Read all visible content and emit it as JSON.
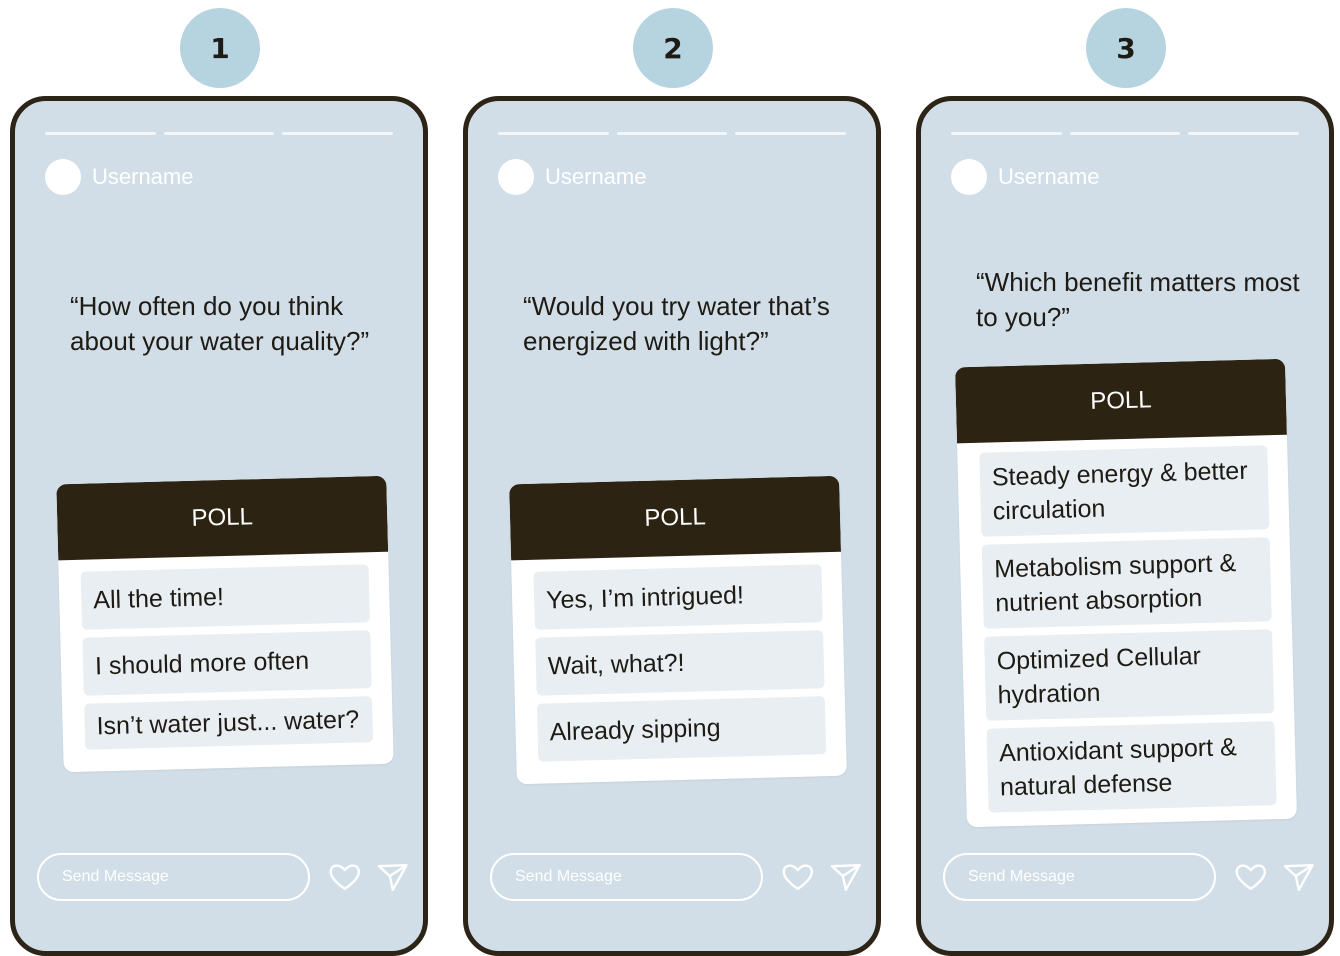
{
  "stories": [
    {
      "number": "1",
      "username": "Username",
      "question": "“How often do you think about your water quality?”",
      "poll_label": "POLL",
      "options": [
        "All the time!",
        "I should more often",
        "Isn’t water just... water?"
      ],
      "message_placeholder": "Send Message"
    },
    {
      "number": "2",
      "username": "Username",
      "question": "“Would you try water that’s energized with light?”",
      "poll_label": "POLL",
      "options": [
        "Yes, I’m intrigued!",
        "Wait, what?!",
        "Already sipping"
      ],
      "message_placeholder": "Send Message"
    },
    {
      "number": "3",
      "username": "Username",
      "question": "“Which benefit matters most to you?”",
      "poll_label": "POLL",
      "options": [
        "Steady energy & better circulation",
        "Metabolism support & nutrient absorption",
        "Optimized Cellular hydration",
        "Antioxidant support & natural defense"
      ],
      "message_placeholder": "Send Message"
    }
  ],
  "icons": {
    "like": "heart-icon",
    "send": "paper-plane-icon"
  },
  "colors": {
    "badge": "#b6d4e0",
    "phone_bg": "#d1dee7",
    "frame": "#2c2417",
    "poll_header": "#2c2313",
    "option_bg": "#e8eef2"
  }
}
